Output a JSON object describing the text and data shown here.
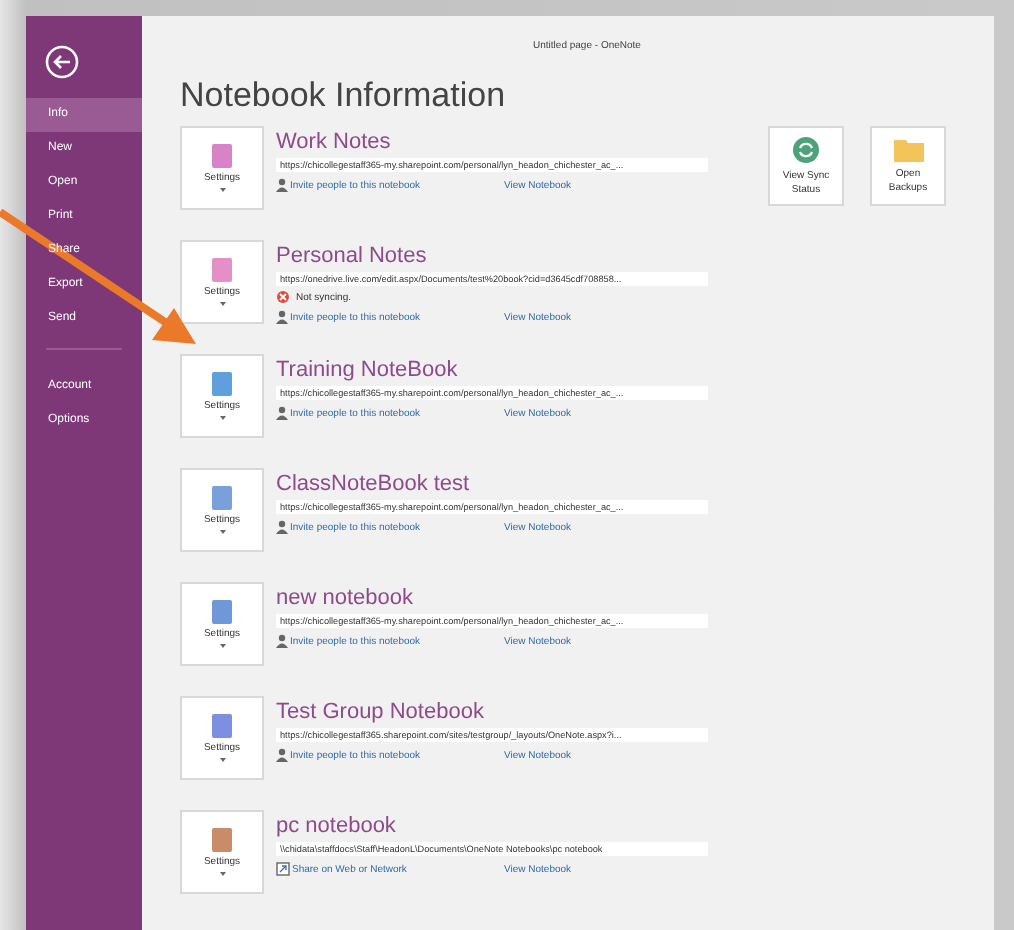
{
  "window": {
    "title": "Untitled page - OneNote"
  },
  "sidebar": {
    "items": [
      {
        "label": "Info",
        "selected": true
      },
      {
        "label": "New",
        "selected": false
      },
      {
        "label": "Open",
        "selected": false
      },
      {
        "label": "Print",
        "selected": false
      },
      {
        "label": "Share",
        "selected": false
      },
      {
        "label": "Export",
        "selected": false
      },
      {
        "label": "Send",
        "selected": false
      }
    ],
    "footer_items": [
      {
        "label": "Account",
        "selected": false
      },
      {
        "label": "Options",
        "selected": false
      }
    ]
  },
  "heading": "Notebook Information",
  "actions": [
    {
      "kind": "sync",
      "label": "View Sync\nStatus"
    },
    {
      "kind": "backups",
      "label": "Open\nBackups"
    }
  ],
  "notebooks": [
    {
      "name": "Work Notes",
      "color": "#d882c8",
      "settings": "Settings",
      "url": "https://chicollegestaff365-my.sharepoint.com/personal/lyn_headon_chichester_ac_...",
      "link": {
        "kind": "invite",
        "label": "Invite people to this notebook"
      },
      "view": "View Notebook"
    },
    {
      "name": "Personal Notes",
      "color": "#e48fc8",
      "settings": "Settings",
      "url": "https://onedrive.live.com/edit.aspx/Documents/test%20book?cid=d3645cdf708858...",
      "status": "Not syncing.",
      "link": {
        "kind": "invite",
        "label": "Invite people to this notebook"
      },
      "view": "View Notebook"
    },
    {
      "name": "Training NoteBook",
      "color": "#5e9fdc",
      "settings": "Settings",
      "url": "https://chicollegestaff365-my.sharepoint.com/personal/lyn_headon_chichester_ac_...",
      "link": {
        "kind": "invite",
        "label": "Invite people to this notebook"
      },
      "view": "View Notebook"
    },
    {
      "name": "ClassNoteBook test",
      "color": "#7aa0dc",
      "settings": "Settings",
      "url": "https://chicollegestaff365-my.sharepoint.com/personal/lyn_headon_chichester_ac_...",
      "link": {
        "kind": "invite",
        "label": "Invite people to this notebook"
      },
      "view": "View Notebook"
    },
    {
      "name": "new notebook",
      "color": "#6f98d8",
      "settings": "Settings",
      "url": "https://chicollegestaff365-my.sharepoint.com/personal/lyn_headon_chichester_ac_...",
      "link": {
        "kind": "invite",
        "label": "Invite people to this notebook"
      },
      "view": "View Notebook"
    },
    {
      "name": "Test Group Notebook",
      "color": "#7c8fe0",
      "settings": "Settings",
      "url": "https://chicollegestaff365.sharepoint.com/sites/testgroup/_layouts/OneNote.aspx?i...",
      "link": {
        "kind": "invite",
        "label": "Invite people to this notebook"
      },
      "view": "View Notebook"
    },
    {
      "name": "pc notebook",
      "color": "#c98c68",
      "settings": "Settings",
      "url": "\\\\chidata\\staffdocs\\Staff\\HeadonL\\Documents\\OneNote Notebooks\\pc notebook",
      "link": {
        "kind": "share",
        "label": "Share on Web or Network"
      },
      "view": "View Notebook"
    }
  ]
}
